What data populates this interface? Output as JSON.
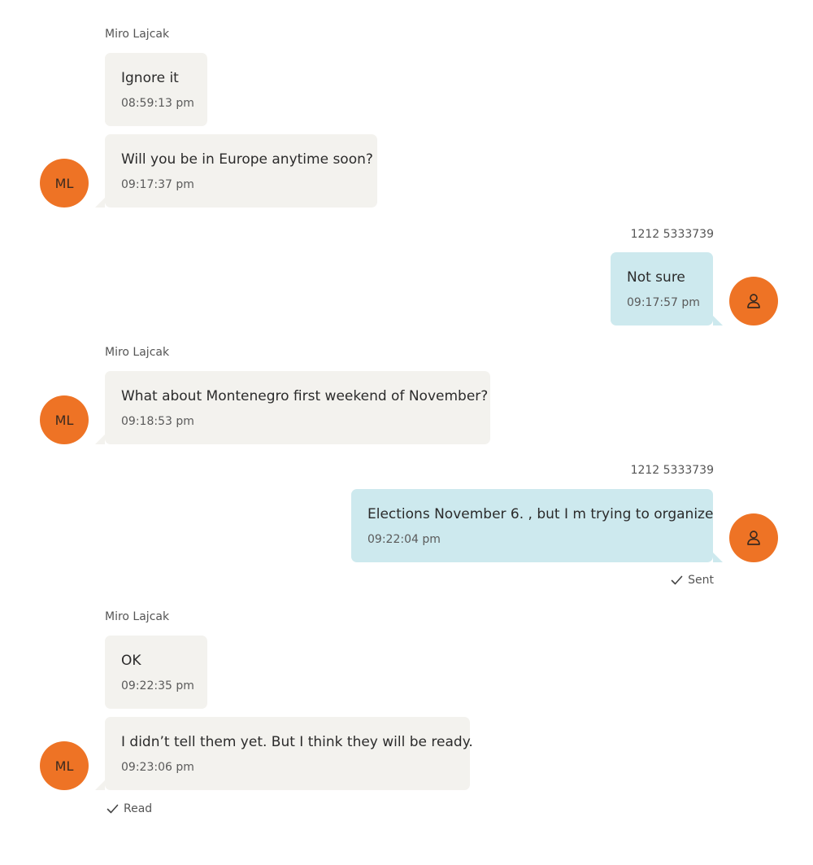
{
  "colors": {
    "avatar": "#ee7325",
    "incoming_bubble": "#f3f2ee",
    "outgoing_bubble": "#cde9ee"
  },
  "contact": {
    "name": "Miro Lajcak",
    "initials": "ML"
  },
  "me": {
    "number": "1212 5333739",
    "avatar_icon": "person-icon"
  },
  "messages": [
    {
      "direction": "in",
      "text": "Ignore it",
      "time": "08:59:13 pm"
    },
    {
      "direction": "in",
      "text": "Will you be in Europe anytime soon?",
      "time": "09:17:37 pm"
    },
    {
      "direction": "out",
      "text": "Not sure",
      "time": "09:17:57 pm"
    },
    {
      "direction": "in",
      "text": "What about Montenegro first weekend of November?",
      "time": "09:18:53 pm"
    },
    {
      "direction": "out",
      "text": "Elections November 6. ,  but I m trying to organize",
      "time": "09:22:04 pm",
      "status": "Sent"
    },
    {
      "direction": "in",
      "text": "OK",
      "time": "09:22:35 pm"
    },
    {
      "direction": "in",
      "text": "I didn’t tell them yet. But I think they will be ready.",
      "time": "09:23:06 pm",
      "status": "Read"
    }
  ]
}
